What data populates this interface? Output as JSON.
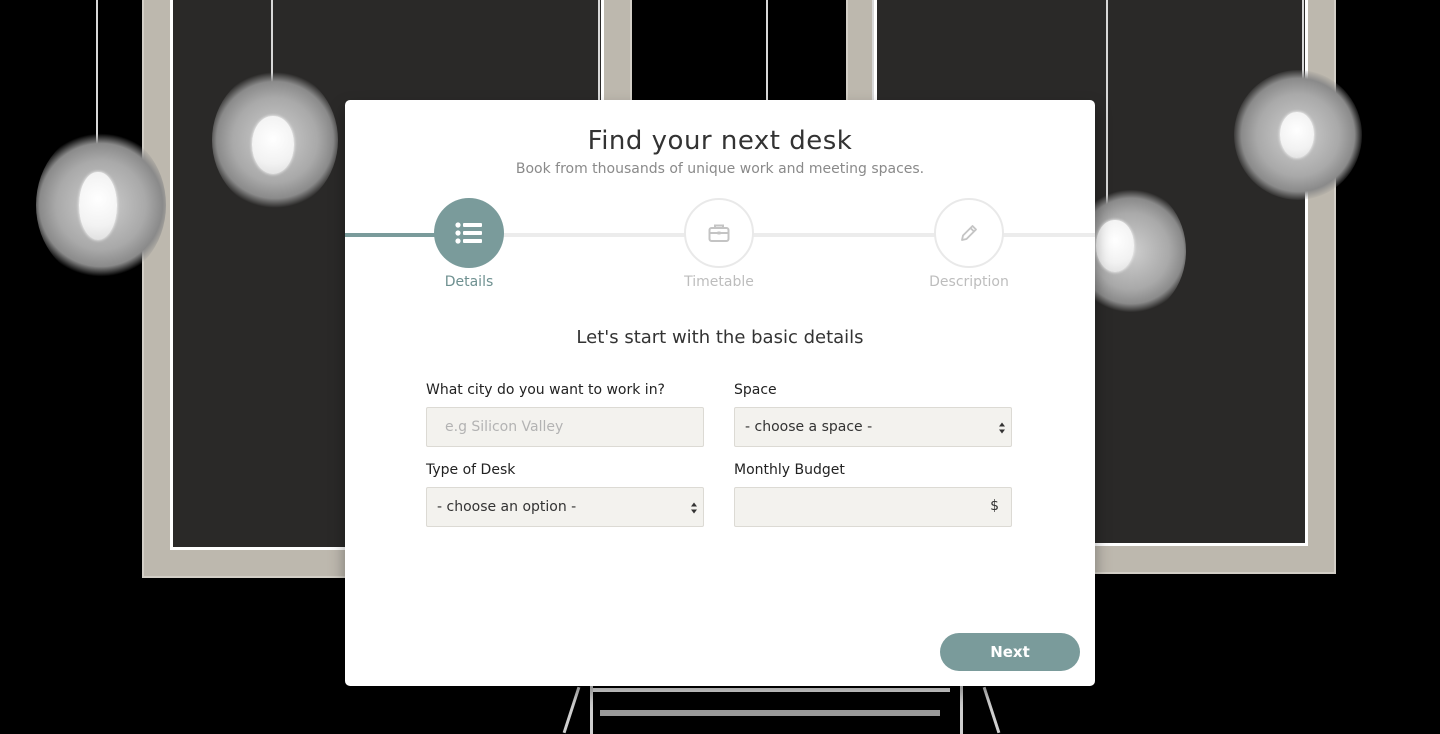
{
  "header": {
    "title": "Find your next desk",
    "subtitle": "Book from thousands of unique work and meeting spaces."
  },
  "stepper": {
    "steps": [
      {
        "label": "Details",
        "icon": "list-icon",
        "active": true
      },
      {
        "label": "Timetable",
        "icon": "briefcase-icon",
        "active": false
      },
      {
        "label": "Description",
        "icon": "pencil-icon",
        "active": false
      }
    ]
  },
  "form": {
    "heading": "Let's start with the basic details",
    "city": {
      "label": "What city do you want to work in?",
      "placeholder": "e.g Silicon Valley",
      "value": ""
    },
    "space": {
      "label": "Space",
      "selected": "- choose a space -"
    },
    "desk_type": {
      "label": "Type of Desk",
      "selected": "- choose an option -"
    },
    "budget": {
      "label": "Monthly Budget",
      "currency": "$",
      "value": ""
    }
  },
  "actions": {
    "next_label": "Next"
  },
  "colors": {
    "accent": "#7a9b9b",
    "inactive_step": "#bdbdbd",
    "field_bg": "#f3f2ee"
  }
}
